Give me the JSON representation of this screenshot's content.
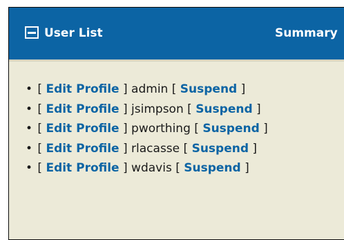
{
  "panel": {
    "title": "User List",
    "summary_label": "Summary",
    "toggle_icon": "minus-box-icon",
    "colors": {
      "header_bg": "#0c64a4",
      "panel_bg": "#ecead8",
      "link": "#0c64a4",
      "text": "#1a1a1a"
    }
  },
  "users": [
    {
      "bullet": "•",
      "edit_label": "Edit Profile",
      "name": "admin",
      "suspend_label": "Suspend"
    },
    {
      "bullet": "•",
      "edit_label": "Edit Profile",
      "name": "jsimpson",
      "suspend_label": "Suspend"
    },
    {
      "bullet": "•",
      "edit_label": "Edit Profile",
      "name": "pworthing",
      "suspend_label": "Suspend"
    },
    {
      "bullet": "•",
      "edit_label": "Edit Profile",
      "name": "rlacasse",
      "suspend_label": "Suspend"
    },
    {
      "bullet": "•",
      "edit_label": "Edit Profile",
      "name": "wdavis",
      "suspend_label": "Suspend"
    }
  ]
}
